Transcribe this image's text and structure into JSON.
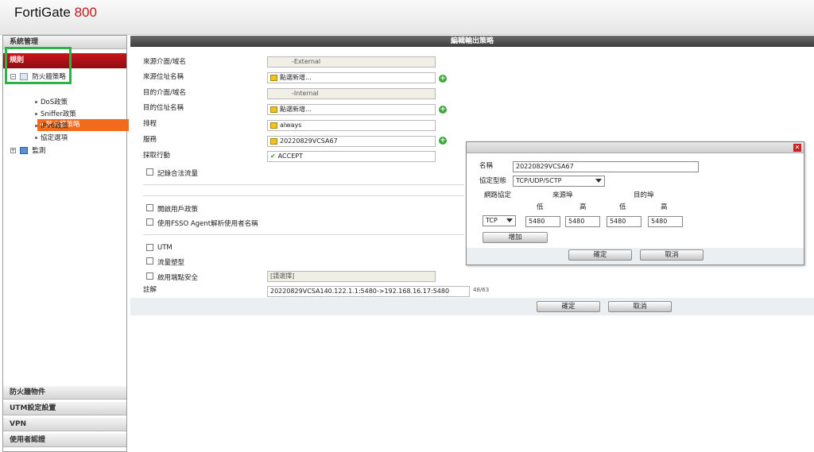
{
  "header": {
    "brand": "FortiGate",
    "model": "800"
  },
  "sidebar": {
    "system_section": "系統管理",
    "active_section": "規則",
    "tree": {
      "firewall_policy_parent": "防火牆策略",
      "firewall_policy_child": "防火牆策略",
      "dos_policy": "DoS政策",
      "sniffer_policy": "Sniffer政策",
      "ipv6_policy": "IPv6政策",
      "protocol_options": "協定選項",
      "monitor": "監測"
    },
    "bottom_sections": [
      "防火牆物件",
      "UTM設定設置",
      "VPN",
      "使用者認證"
    ]
  },
  "main": {
    "title": "編輯輸出策略",
    "labels": {
      "src_interface": "來源介面/域名",
      "src_address": "來源位址名稱",
      "dst_interface": "目的介面/域名",
      "dst_address": "目的位址名稱",
      "schedule": "排程",
      "service": "服務",
      "action": "採取行動",
      "log_traffic": "記錄合法流量",
      "user_policy": "開啟用戶政策",
      "fsso": "使用FSSO Agent解析使用者名稱",
      "utm": "UTM",
      "traffic_shaping": "流量塑型",
      "endpoint_security": "啟用端點安全",
      "comments": "註解"
    },
    "values": {
      "src_interface": "-External",
      "src_address": "點選新增...",
      "dst_interface": "-Internal",
      "dst_address": "點選新增...",
      "schedule": "always",
      "service": "20220829VCSA67",
      "action": "ACCEPT",
      "endpoint_security": "[請選擇]",
      "comments": "20220829VCSA140.122.1.1:5480->192.168.16.17:5480",
      "comment_count": "48/63"
    },
    "ok_label": "確定",
    "cancel_label": "取消"
  },
  "dialog": {
    "name_label": "名稱",
    "name_value": "20220829VCSA67",
    "protocol_type_label": "協定型態",
    "protocol_type_value": "TCP/UDP/SCTP",
    "col_protocol": "網路協定",
    "col_src_port": "來源埠",
    "col_dst_port": "目的埠",
    "low": "低",
    "high": "高",
    "protocol_value": "TCP",
    "src_low": "5480",
    "src_high": "5480",
    "dst_low": "5480",
    "dst_high": "5480",
    "add_label": "增加",
    "ok_label": "確定",
    "cancel_label": "取消"
  },
  "colors": {
    "accent_red": "#c4161c",
    "selected_orange": "#f26a1b",
    "highlight_green": "#2db24a"
  }
}
